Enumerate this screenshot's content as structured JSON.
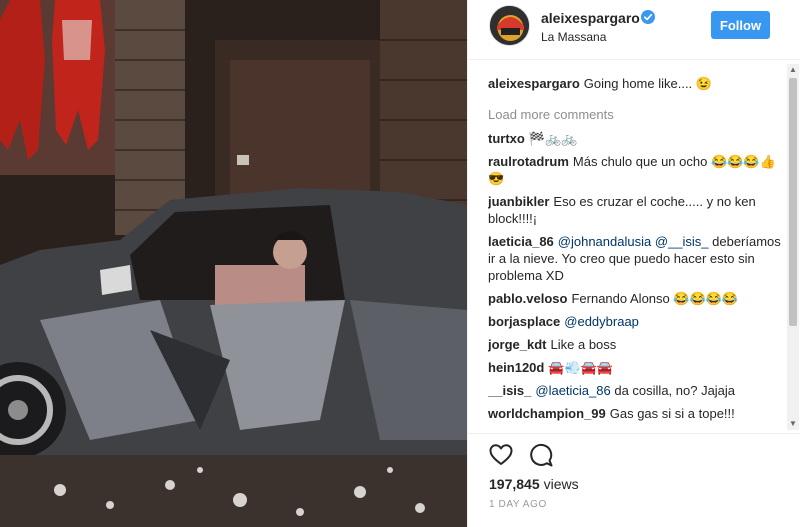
{
  "post": {
    "username": "aleixespargaro",
    "location": "La Massana",
    "follow_label": "Follow"
  },
  "caption": {
    "user": "aleixespargaro",
    "text": "Going home like.... 😉"
  },
  "load_more_label": "Load more comments",
  "comments": [
    {
      "user": "turtxo",
      "parts": [
        {
          "t": "text",
          "v": "🏁🚲🚲"
        }
      ]
    },
    {
      "user": "raulrotadrum",
      "parts": [
        {
          "t": "text",
          "v": "Más chulo que un ocho 😂😂😂👍😎"
        }
      ]
    },
    {
      "user": "juanbikler",
      "parts": [
        {
          "t": "text",
          "v": "Eso es cruzar el coche..... y no ken block!!!!¡"
        }
      ]
    },
    {
      "user": "laeticia_86",
      "parts": [
        {
          "t": "mention",
          "v": "@johnandalusia"
        },
        {
          "t": "text",
          "v": " "
        },
        {
          "t": "mention",
          "v": "@__isis_"
        },
        {
          "t": "text",
          "v": " deberíamos ir a la nieve. Yo creo que puedo hacer esto sin problema XD"
        }
      ]
    },
    {
      "user": "pablo.veloso",
      "parts": [
        {
          "t": "text",
          "v": "Fernando Alonso 😂😂😂😂"
        }
      ]
    },
    {
      "user": "borjasplace",
      "parts": [
        {
          "t": "mention",
          "v": "@eddybraap"
        }
      ]
    },
    {
      "user": "jorge_kdt",
      "parts": [
        {
          "t": "text",
          "v": "Like a boss"
        }
      ]
    },
    {
      "user": "hein120d",
      "parts": [
        {
          "t": "text",
          "v": "🚘💨🚘🚘"
        }
      ]
    },
    {
      "user": "__isis_",
      "parts": [
        {
          "t": "mention",
          "v": "@laeticia_86"
        },
        {
          "t": "text",
          "v": " da cosilla, no? Jajaja"
        }
      ]
    },
    {
      "user": "worldchampion_99",
      "parts": [
        {
          "t": "text",
          "v": "Gas gas si si a tope!!!"
        }
      ]
    }
  ],
  "stats": {
    "views_count": "197,845",
    "views_label": "views",
    "time_ago": "1 DAY AGO"
  },
  "colors": {
    "accent": "#3897f0",
    "mention": "#003569",
    "muted": "#8e8e8e"
  },
  "icons": [
    "verified-badge-icon",
    "heart-icon",
    "comment-bubble-icon"
  ]
}
